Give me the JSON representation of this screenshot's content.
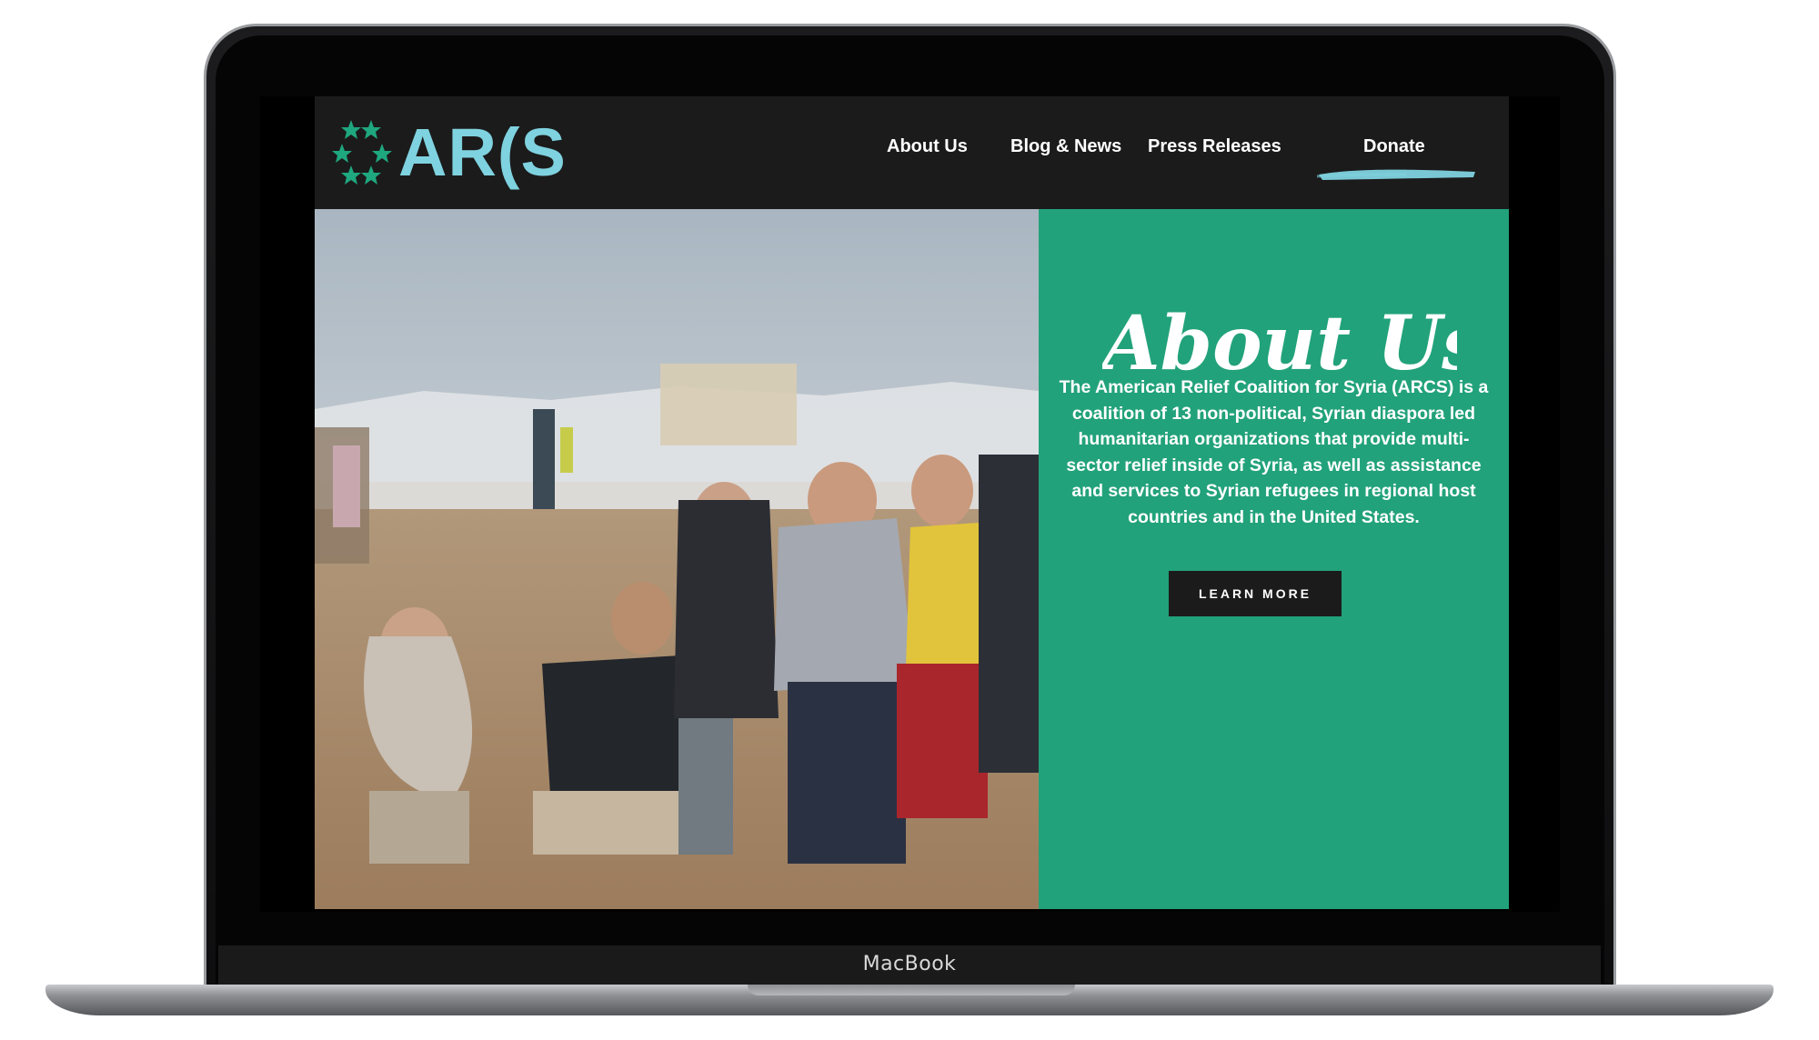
{
  "device": {
    "model_label": "MacBook"
  },
  "site": {
    "logo_text": "AR(S",
    "nav": {
      "items": [
        {
          "label": "About Us"
        },
        {
          "label": "Blog & News"
        },
        {
          "label": "Press Releases"
        }
      ],
      "donate_label": "Donate"
    },
    "hero": {
      "title": "About Us",
      "body": "The American Relief Coalition for Syria (ARCS) is a coalition of 13 non-political, Syrian diaspora led humanitarian organizations that provide multi-sector relief inside of Syria, as well as assistance and services to Syrian refugees in regional host countries and in the United States.",
      "cta_label": "LEARN MORE"
    },
    "colors": {
      "brand_teal": "#7fd2df",
      "star_green": "#1fa77f",
      "panel_green": "#22a27a",
      "header_bg": "#1b1b1b"
    },
    "icons": {
      "logo_stars": "star-ring-icon",
      "donate_accent": "brush-stroke-icon"
    }
  }
}
